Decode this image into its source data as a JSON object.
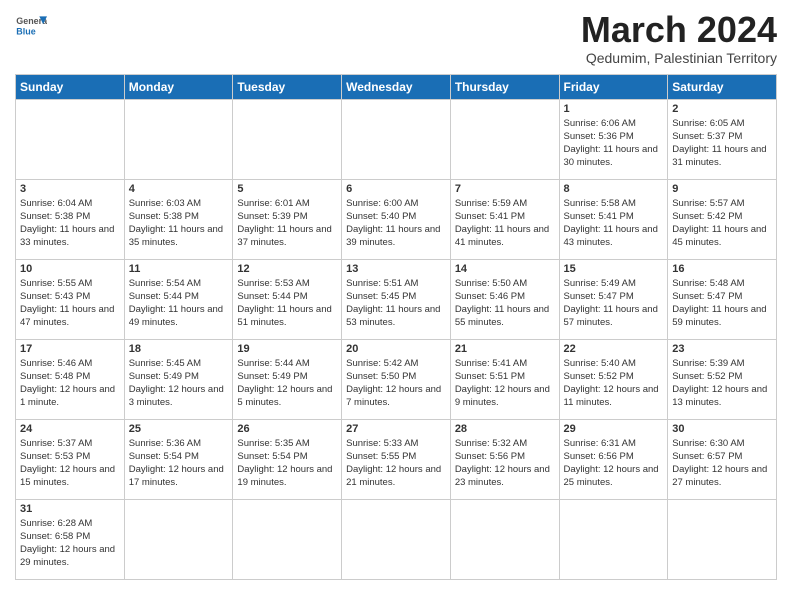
{
  "header": {
    "logo_general": "General",
    "logo_blue": "Blue",
    "month_title": "March 2024",
    "subtitle": "Qedumim, Palestinian Territory"
  },
  "days_of_week": [
    "Sunday",
    "Monday",
    "Tuesday",
    "Wednesday",
    "Thursday",
    "Friday",
    "Saturday"
  ],
  "weeks": [
    [
      {
        "day": "",
        "info": ""
      },
      {
        "day": "",
        "info": ""
      },
      {
        "day": "",
        "info": ""
      },
      {
        "day": "",
        "info": ""
      },
      {
        "day": "",
        "info": ""
      },
      {
        "day": "1",
        "info": "Sunrise: 6:06 AM\nSunset: 5:36 PM\nDaylight: 11 hours and 30 minutes."
      },
      {
        "day": "2",
        "info": "Sunrise: 6:05 AM\nSunset: 5:37 PM\nDaylight: 11 hours and 31 minutes."
      }
    ],
    [
      {
        "day": "3",
        "info": "Sunrise: 6:04 AM\nSunset: 5:38 PM\nDaylight: 11 hours and 33 minutes."
      },
      {
        "day": "4",
        "info": "Sunrise: 6:03 AM\nSunset: 5:38 PM\nDaylight: 11 hours and 35 minutes."
      },
      {
        "day": "5",
        "info": "Sunrise: 6:01 AM\nSunset: 5:39 PM\nDaylight: 11 hours and 37 minutes."
      },
      {
        "day": "6",
        "info": "Sunrise: 6:00 AM\nSunset: 5:40 PM\nDaylight: 11 hours and 39 minutes."
      },
      {
        "day": "7",
        "info": "Sunrise: 5:59 AM\nSunset: 5:41 PM\nDaylight: 11 hours and 41 minutes."
      },
      {
        "day": "8",
        "info": "Sunrise: 5:58 AM\nSunset: 5:41 PM\nDaylight: 11 hours and 43 minutes."
      },
      {
        "day": "9",
        "info": "Sunrise: 5:57 AM\nSunset: 5:42 PM\nDaylight: 11 hours and 45 minutes."
      }
    ],
    [
      {
        "day": "10",
        "info": "Sunrise: 5:55 AM\nSunset: 5:43 PM\nDaylight: 11 hours and 47 minutes."
      },
      {
        "day": "11",
        "info": "Sunrise: 5:54 AM\nSunset: 5:44 PM\nDaylight: 11 hours and 49 minutes."
      },
      {
        "day": "12",
        "info": "Sunrise: 5:53 AM\nSunset: 5:44 PM\nDaylight: 11 hours and 51 minutes."
      },
      {
        "day": "13",
        "info": "Sunrise: 5:51 AM\nSunset: 5:45 PM\nDaylight: 11 hours and 53 minutes."
      },
      {
        "day": "14",
        "info": "Sunrise: 5:50 AM\nSunset: 5:46 PM\nDaylight: 11 hours and 55 minutes."
      },
      {
        "day": "15",
        "info": "Sunrise: 5:49 AM\nSunset: 5:47 PM\nDaylight: 11 hours and 57 minutes."
      },
      {
        "day": "16",
        "info": "Sunrise: 5:48 AM\nSunset: 5:47 PM\nDaylight: 11 hours and 59 minutes."
      }
    ],
    [
      {
        "day": "17",
        "info": "Sunrise: 5:46 AM\nSunset: 5:48 PM\nDaylight: 12 hours and 1 minute."
      },
      {
        "day": "18",
        "info": "Sunrise: 5:45 AM\nSunset: 5:49 PM\nDaylight: 12 hours and 3 minutes."
      },
      {
        "day": "19",
        "info": "Sunrise: 5:44 AM\nSunset: 5:49 PM\nDaylight: 12 hours and 5 minutes."
      },
      {
        "day": "20",
        "info": "Sunrise: 5:42 AM\nSunset: 5:50 PM\nDaylight: 12 hours and 7 minutes."
      },
      {
        "day": "21",
        "info": "Sunrise: 5:41 AM\nSunset: 5:51 PM\nDaylight: 12 hours and 9 minutes."
      },
      {
        "day": "22",
        "info": "Sunrise: 5:40 AM\nSunset: 5:52 PM\nDaylight: 12 hours and 11 minutes."
      },
      {
        "day": "23",
        "info": "Sunrise: 5:39 AM\nSunset: 5:52 PM\nDaylight: 12 hours and 13 minutes."
      }
    ],
    [
      {
        "day": "24",
        "info": "Sunrise: 5:37 AM\nSunset: 5:53 PM\nDaylight: 12 hours and 15 minutes."
      },
      {
        "day": "25",
        "info": "Sunrise: 5:36 AM\nSunset: 5:54 PM\nDaylight: 12 hours and 17 minutes."
      },
      {
        "day": "26",
        "info": "Sunrise: 5:35 AM\nSunset: 5:54 PM\nDaylight: 12 hours and 19 minutes."
      },
      {
        "day": "27",
        "info": "Sunrise: 5:33 AM\nSunset: 5:55 PM\nDaylight: 12 hours and 21 minutes."
      },
      {
        "day": "28",
        "info": "Sunrise: 5:32 AM\nSunset: 5:56 PM\nDaylight: 12 hours and 23 minutes."
      },
      {
        "day": "29",
        "info": "Sunrise: 6:31 AM\nSunset: 6:56 PM\nDaylight: 12 hours and 25 minutes."
      },
      {
        "day": "30",
        "info": "Sunrise: 6:30 AM\nSunset: 6:57 PM\nDaylight: 12 hours and 27 minutes."
      }
    ],
    [
      {
        "day": "31",
        "info": "Sunrise: 6:28 AM\nSunset: 6:58 PM\nDaylight: 12 hours and 29 minutes."
      },
      {
        "day": "",
        "info": ""
      },
      {
        "day": "",
        "info": ""
      },
      {
        "day": "",
        "info": ""
      },
      {
        "day": "",
        "info": ""
      },
      {
        "day": "",
        "info": ""
      },
      {
        "day": "",
        "info": ""
      }
    ]
  ]
}
